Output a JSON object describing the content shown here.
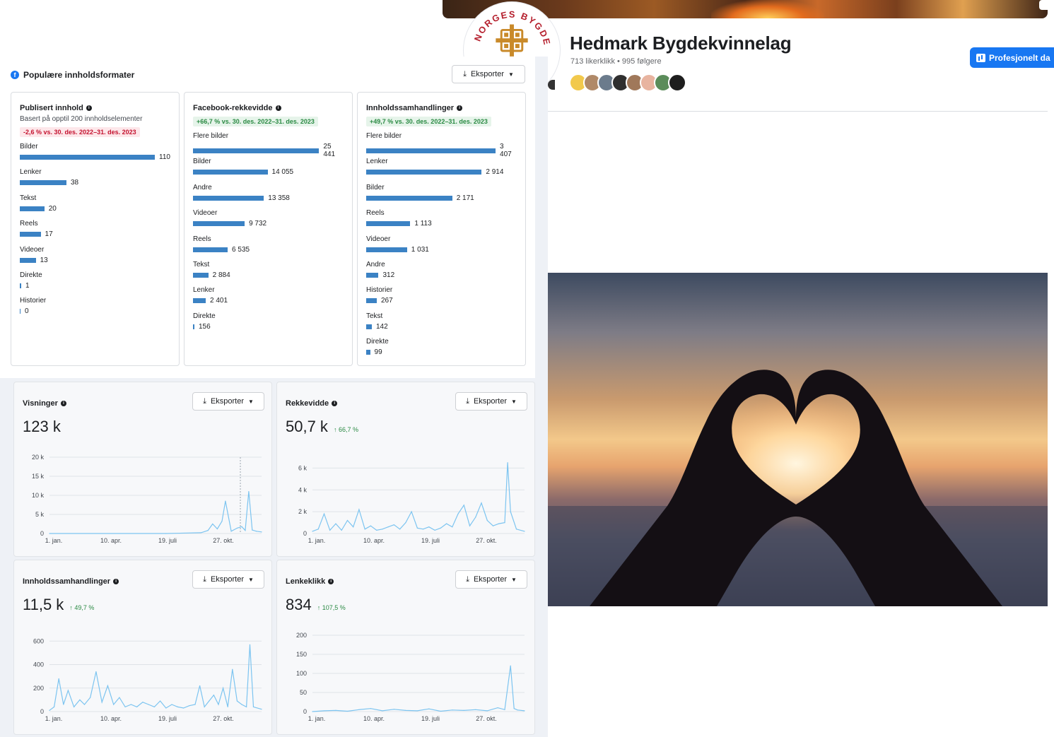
{
  "page": {
    "name": "Hedmark Bygdekvinnelag",
    "stats": "713 likerklikk • 995 følgere",
    "button_label": "Profesjonelt da",
    "logo_text": "NORGES BYGDEKVINNELAG"
  },
  "insights": {
    "title": "Populære innholdsformater",
    "export_label": "Eksporter",
    "cards": [
      {
        "title": "Publisert innhold",
        "subtitle": "Basert på opptil 200 innholdselementer",
        "badge": "-2,6 % vs. 30. des. 2022–31. des. 2023",
        "badge_type": "negative",
        "items": [
          {
            "label": "Bilder",
            "value": "110",
            "n": 110
          },
          {
            "label": "Lenker",
            "value": "38",
            "n": 38
          },
          {
            "label": "Tekst",
            "value": "20",
            "n": 20
          },
          {
            "label": "Reels",
            "value": "17",
            "n": 17
          },
          {
            "label": "Videoer",
            "value": "13",
            "n": 13
          },
          {
            "label": "Direkte",
            "value": "1",
            "n": 1
          },
          {
            "label": "Historier",
            "value": "0",
            "n": 0
          }
        ]
      },
      {
        "title": "Facebook-rekkevidde",
        "subtitle": "",
        "badge": "+66,7 % vs. 30. des. 2022–31. des. 2023",
        "badge_type": "positive",
        "items": [
          {
            "label": "Flere bilder",
            "value": "25 441",
            "n": 25441
          },
          {
            "label": "Bilder",
            "value": "14 055",
            "n": 14055
          },
          {
            "label": "Andre",
            "value": "13 358",
            "n": 13358
          },
          {
            "label": "Videoer",
            "value": "9 732",
            "n": 9732
          },
          {
            "label": "Reels",
            "value": "6 535",
            "n": 6535
          },
          {
            "label": "Tekst",
            "value": "2 884",
            "n": 2884
          },
          {
            "label": "Lenker",
            "value": "2 401",
            "n": 2401
          },
          {
            "label": "Direkte",
            "value": "156",
            "n": 156
          }
        ]
      },
      {
        "title": "Innholdssamhandlinger",
        "subtitle": "",
        "badge": "+49,7 % vs. 30. des. 2022–31. des. 2023",
        "badge_type": "positive",
        "items": [
          {
            "label": "Flere bilder",
            "value": "3 407",
            "n": 3407
          },
          {
            "label": "Lenker",
            "value": "2 914",
            "n": 2914
          },
          {
            "label": "Bilder",
            "value": "2 171",
            "n": 2171
          },
          {
            "label": "Reels",
            "value": "1 113",
            "n": 1113
          },
          {
            "label": "Videoer",
            "value": "1 031",
            "n": 1031
          },
          {
            "label": "Andre",
            "value": "312",
            "n": 312
          },
          {
            "label": "Historier",
            "value": "267",
            "n": 267
          },
          {
            "label": "Tekst",
            "value": "142",
            "n": 142
          },
          {
            "label": "Direkte",
            "value": "99",
            "n": 99
          }
        ]
      }
    ]
  },
  "metrics": [
    {
      "title": "Visninger",
      "value": "123 k",
      "delta": "",
      "export_label": "Eksporter"
    },
    {
      "title": "Rekkevidde",
      "value": "50,7 k",
      "delta": "↑ 66,7 %",
      "export_label": "Eksporter"
    },
    {
      "title": "Innholdssamhandlinger",
      "value": "11,5 k",
      "delta": "↑ 49,7 %",
      "export_label": "Eksporter"
    },
    {
      "title": "Lenkeklikk",
      "value": "834",
      "delta": "↑ 107,5 %",
      "export_label": "Eksporter"
    }
  ],
  "chart_data": [
    {
      "type": "area",
      "title": "Visninger",
      "x_ticks": [
        "1. jan.",
        "10. apr.",
        "19. juli",
        "27. okt."
      ],
      "y_ticks": [
        "0",
        "5 k",
        "10 k",
        "15 k",
        "20 k"
      ],
      "ylim": [
        0,
        20000
      ],
      "series": [
        {
          "x": [
            0,
            200,
            260,
            272,
            280,
            288,
            296,
            302,
            312,
            322,
            330,
            336,
            342,
            348,
            355,
            364
          ],
          "values": [
            0,
            0,
            200,
            800,
            2500,
            1200,
            3200,
            8500,
            600,
            1400,
            1800,
            800,
            11000,
            900,
            600,
            400
          ]
        }
      ]
    },
    {
      "type": "area",
      "title": "Rekkevidde",
      "x_ticks": [
        "1. jan.",
        "10. apr.",
        "19. juli",
        "27. okt."
      ],
      "y_ticks": [
        "0",
        "2 k",
        "4 k",
        "6 k"
      ],
      "ylim": [
        0,
        7000
      ],
      "series": [
        {
          "x": [
            0,
            10,
            20,
            30,
            40,
            50,
            60,
            70,
            80,
            90,
            100,
            110,
            120,
            130,
            140,
            150,
            160,
            170,
            180,
            190,
            200,
            210,
            220,
            230,
            240,
            250,
            260,
            270,
            280,
            290,
            300,
            310,
            320,
            330,
            335,
            340,
            350,
            364
          ],
          "values": [
            200,
            400,
            1800,
            300,
            900,
            300,
            1200,
            600,
            2200,
            400,
            700,
            300,
            400,
            600,
            800,
            400,
            1000,
            2000,
            500,
            400,
            600,
            300,
            500,
            900,
            600,
            1800,
            2600,
            700,
            1500,
            2800,
            1200,
            700,
            900,
            1000,
            6500,
            2000,
            400,
            200
          ]
        }
      ]
    },
    {
      "type": "area",
      "title": "Innholdssamhandlinger",
      "x_ticks": [
        "1. jan.",
        "10. apr.",
        "19. juli",
        "27. okt."
      ],
      "y_ticks": [
        "0",
        "200",
        "400",
        "600"
      ],
      "ylim": [
        0,
        650
      ],
      "series": [
        {
          "x": [
            0,
            8,
            16,
            24,
            32,
            42,
            52,
            60,
            70,
            80,
            90,
            100,
            110,
            120,
            130,
            140,
            150,
            160,
            170,
            180,
            190,
            200,
            210,
            220,
            230,
            240,
            250,
            258,
            266,
            274,
            282,
            290,
            298,
            306,
            314,
            322,
            330,
            338,
            344,
            350,
            364
          ],
          "values": [
            10,
            40,
            280,
            60,
            180,
            40,
            100,
            60,
            120,
            340,
            80,
            220,
            60,
            120,
            40,
            60,
            40,
            80,
            60,
            40,
            90,
            30,
            60,
            40,
            30,
            50,
            60,
            220,
            40,
            90,
            140,
            60,
            200,
            40,
            360,
            90,
            60,
            40,
            570,
            40,
            20
          ]
        }
      ]
    },
    {
      "type": "area",
      "title": "Lenkeklikk",
      "x_ticks": [
        "1. jan.",
        "10. apr.",
        "19. juli",
        "27. okt."
      ],
      "y_ticks": [
        "0",
        "50",
        "100",
        "150",
        "200"
      ],
      "ylim": [
        0,
        200
      ],
      "series": [
        {
          "x": [
            0,
            20,
            40,
            60,
            80,
            100,
            120,
            140,
            160,
            180,
            200,
            220,
            240,
            260,
            280,
            300,
            318,
            330,
            340,
            346,
            352,
            364
          ],
          "values": [
            0,
            2,
            3,
            1,
            5,
            8,
            2,
            6,
            3,
            2,
            7,
            1,
            4,
            3,
            5,
            2,
            10,
            5,
            120,
            8,
            4,
            2
          ]
        }
      ]
    }
  ]
}
